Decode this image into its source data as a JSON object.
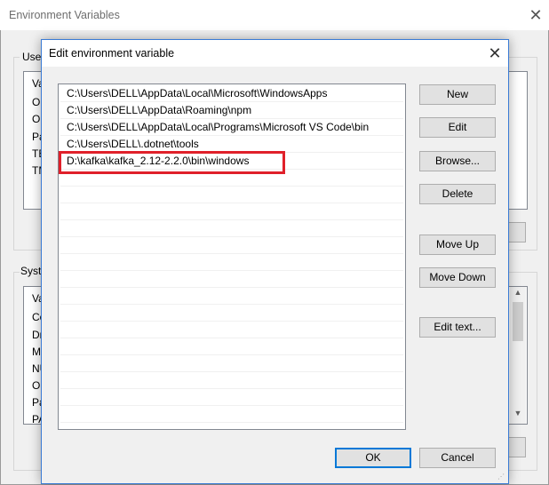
{
  "background_window": {
    "title": "Environment Variables",
    "close_glyph": "✕",
    "user_section_label": "User",
    "user_list_peek": [
      "Va",
      "On",
      "On",
      "Pa",
      "TE",
      "TM"
    ],
    "system_section_label": "Syste",
    "system_list_peek": [
      "Va",
      "Co",
      "Dr",
      "M",
      "NU",
      "OS",
      "Pa",
      "PA"
    ],
    "scroll_up_glyph": "▲",
    "scroll_down_glyph": "▼"
  },
  "dialog": {
    "title": "Edit environment variable",
    "close_glyph": "✕",
    "entries": [
      "C:\\Users\\DELL\\AppData\\Local\\Microsoft\\WindowsApps",
      "C:\\Users\\DELL\\AppData\\Roaming\\npm",
      "C:\\Users\\DELL\\AppData\\Local\\Programs\\Microsoft VS Code\\bin",
      "C:\\Users\\DELL\\.dotnet\\tools",
      "D:\\kafka\\kafka_2.12-2.2.0\\bin\\windows"
    ],
    "highlight_color": "#e0202a",
    "buttons": {
      "new": "New",
      "edit": "Edit",
      "browse": "Browse...",
      "delete": "Delete",
      "move_up": "Move Up",
      "move_down": "Move Down",
      "edit_text": "Edit text...",
      "ok": "OK",
      "cancel": "Cancel"
    },
    "resize_grip_glyph": "⋰"
  }
}
